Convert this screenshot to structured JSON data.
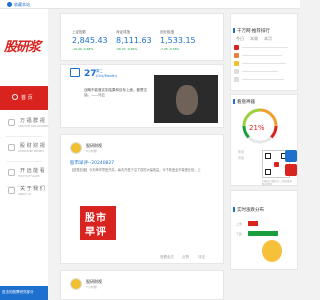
{
  "topbar": {
    "text": "收藏本站"
  },
  "sidebar": {
    "logo": "股研浆",
    "items": [
      {
        "title": "首 页",
        "sub": "",
        "active": true
      },
      {
        "title": "万 福 群 视",
        "sub": "CREATIVE DISCLOSURES",
        "active": false
      },
      {
        "title": "股 财 财 视",
        "sub": "LITERATURE REVIEW",
        "active": false
      },
      {
        "title": "开 远 能 看",
        "sub": "TRUTH OF VALUE",
        "active": false
      },
      {
        "title": "关 于 我 们",
        "sub": "ABOUT US",
        "active": false
      }
    ],
    "footer": "进击的股票研究部分"
  },
  "indices": [
    {
      "label": "上证指数",
      "value": "2,845.43",
      "change": "-19.49 -0.68%",
      "dir": "down"
    },
    {
      "label": "深证成指",
      "value": "8,111.63",
      "change": "-56.07 -0.69%",
      "dir": "down"
    },
    {
      "label": "创业板指",
      "value": "1,533.15",
      "change": "-7.45 -0.48%",
      "dir": "down"
    }
  ],
  "daily_quote": {
    "day": "27",
    "weekday": "周二",
    "month": "(Oct/Month)",
    "text": "战略不能落实到结果和目标上面，都是空话。——马云"
  },
  "posts": [
    {
      "author": "股研财视",
      "time": "5小时前",
      "title": "股市早评--20240827",
      "body": "【逆势加速】今天两市早盘开高，每天开盘下沿了前的大幅收益。今千收盘全市量差比较，上",
      "badge_line1": "股市",
      "badge_line2": "早评",
      "actions": [
        "查看全文",
        "点赞",
        "评论"
      ]
    },
    {
      "author": "股研财视",
      "time": "7小时前"
    }
  ],
  "right_panels": {
    "rank_title": "千万网·推荐排行",
    "rank_tabs": [
      "今日",
      "本周",
      "本月"
    ],
    "sentiment_title": "看盘神器",
    "sentiment_pct": "21%",
    "sentiment_labels": [
      "悲观",
      "乐观"
    ],
    "qr_caption": "扫描关注微信号，获取更多股市资讯",
    "dist_title": "实时涨跌分布",
    "dist_labels": [
      "上涨",
      "下跌"
    ]
  },
  "colors": {
    "accent": "#d9231f",
    "link": "#1e70cf",
    "down": "#1a9d3c"
  }
}
